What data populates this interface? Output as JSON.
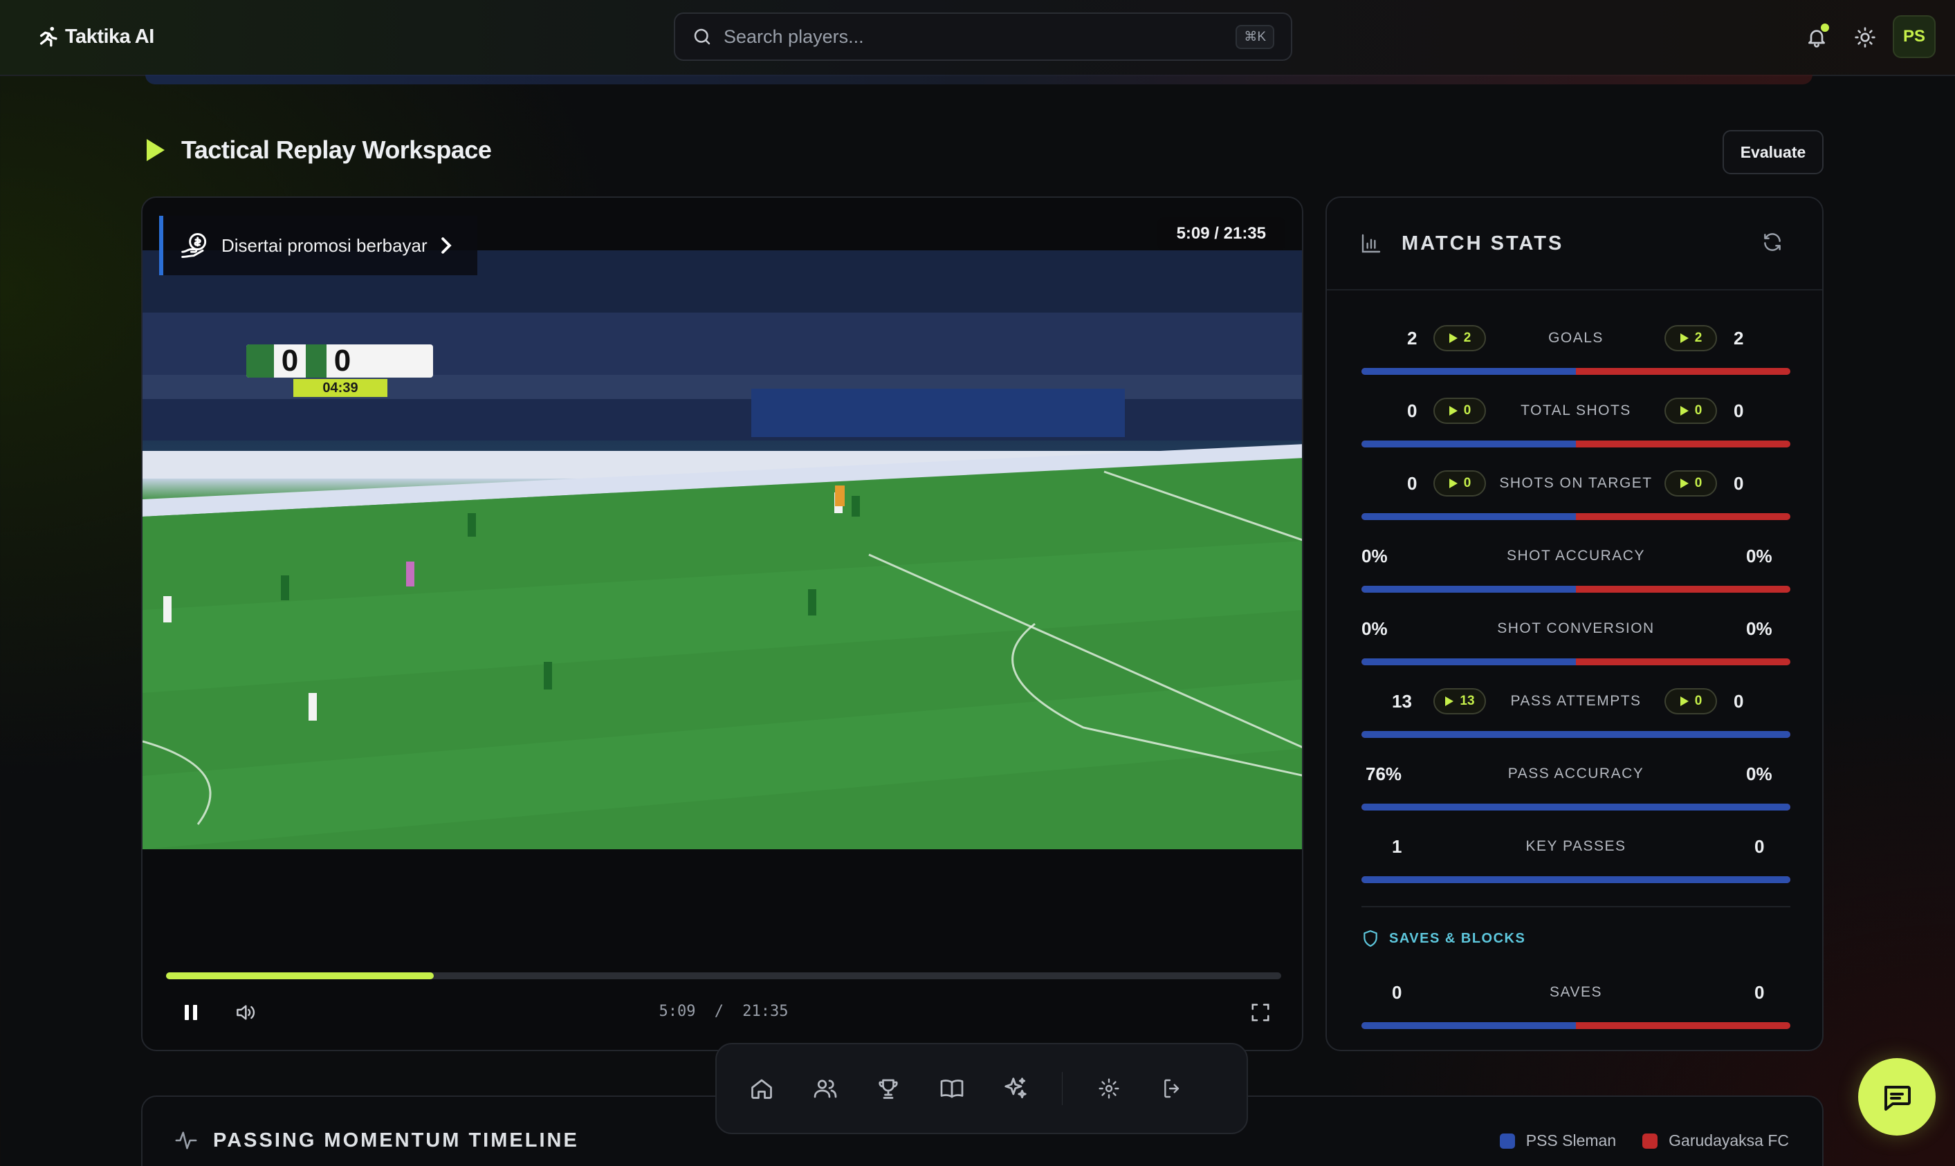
{
  "app": {
    "name": "Taktika AI"
  },
  "header": {
    "search_placeholder": "Search players...",
    "search_shortcut": "⌘K",
    "avatar_initials": "PS"
  },
  "workspace": {
    "title": "Tactical Replay Workspace",
    "evaluate_label": "Evaluate"
  },
  "video": {
    "promo_text": "Disertai promosi berbayar",
    "time_badge": "5:09 / 21:35",
    "scoreboard": {
      "home_score": "0",
      "away_score": "0",
      "match_clock": "04:39"
    },
    "current_time": "5:09",
    "separator": "/",
    "duration": "21:35",
    "progress": 0.24
  },
  "match_stats": {
    "title": "MATCH STATS",
    "rows": [
      {
        "label": "GOALS",
        "home": "2",
        "away": "2",
        "home_chip": "2",
        "away_chip": "2",
        "home_share": 0.5
      },
      {
        "label": "TOTAL SHOTS",
        "home": "0",
        "away": "0",
        "home_chip": "0",
        "away_chip": "0",
        "home_share": 0.5
      },
      {
        "label": "SHOTS ON TARGET",
        "home": "0",
        "away": "0",
        "home_chip": "0",
        "away_chip": "0",
        "home_share": 0.5
      },
      {
        "label": "SHOT ACCURACY",
        "home": "0%",
        "away": "0%",
        "home_share": 0.5
      },
      {
        "label": "SHOT CONVERSION",
        "home": "0%",
        "away": "0%",
        "home_share": 0.5
      },
      {
        "label": "PASS ATTEMPTS",
        "home": "13",
        "away": "0",
        "home_chip": "13",
        "away_chip": "0",
        "home_share": 1.0
      },
      {
        "label": "PASS ACCURACY",
        "home": "76%",
        "away": "0%",
        "home_share": 1.0
      },
      {
        "label": "KEY PASSES",
        "home": "1",
        "away": "0",
        "home_share": 1.0
      }
    ],
    "saves_section": {
      "title": "SAVES & BLOCKS",
      "rows": [
        {
          "label": "SAVES",
          "home": "0",
          "away": "0",
          "home_share": 0.5
        }
      ]
    }
  },
  "timeline": {
    "title": "PASSING MOMENTUM TIMELINE",
    "legend": [
      {
        "name": "PSS Sleman",
        "color": "#2d4fae"
      },
      {
        "name": "Garudayaksa FC",
        "color": "#c02a2a"
      }
    ]
  },
  "colors": {
    "accent": "#c6f04a",
    "home": "#2d4fae",
    "away": "#c02a2a",
    "info": "#5ec8de"
  }
}
